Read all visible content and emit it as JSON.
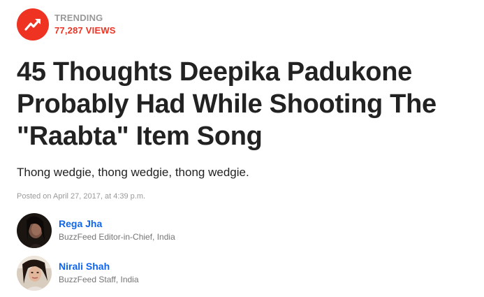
{
  "trending": {
    "label": "TRENDING",
    "views": "77,287 VIEWS",
    "icon": "trending-arrow-icon",
    "accent_color": "#ee3322"
  },
  "article": {
    "headline": "45 Thoughts Deepika Padukone Probably Had While Shooting The \"Raabta\" Item Song",
    "dek": "Thong wedgie, thong wedgie, thong wedgie.",
    "posted": "Posted on April 27, 2017, at 4:39 p.m."
  },
  "authors": [
    {
      "name": "Rega Jha",
      "title": "BuzzFeed Editor-in-Chief, India"
    },
    {
      "name": "Nirali Shah",
      "title": "BuzzFeed Staff, India"
    }
  ],
  "colors": {
    "link": "#0f65ef",
    "muted": "#999999",
    "text": "#222222"
  }
}
